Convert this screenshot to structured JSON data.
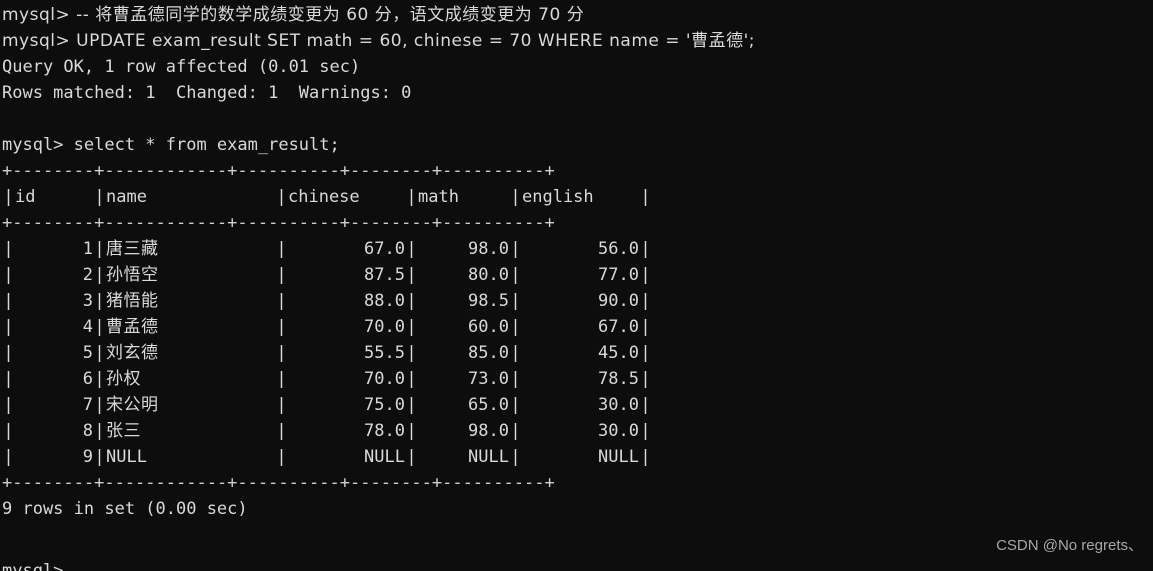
{
  "terminal": {
    "background_color": "#0d0d0d",
    "foreground_color": "#d9d9d9",
    "prompt": "mysql>"
  },
  "session": {
    "line_comment": "mysql> -- 将曹孟德同学的数学成绩变更为 60 分，语文成绩变更为 70 分",
    "line_update": "mysql> UPDATE exam_result SET math = 60, chinese = 70 WHERE name = '曹孟德';",
    "line_query_ok": "Query OK, 1 row affected (0.01 sec)",
    "line_rows_matched": "Rows matched: 1  Changed: 1  Warnings: 0",
    "line_select": "mysql> select * from exam_result;",
    "line_rows_in_set": "9 rows in set (0.00 sec)",
    "line_tail_prompt": "mysql>"
  },
  "result_table": {
    "separator": "+--------+------------+----------+--------+----------+",
    "columns": [
      "id",
      "name",
      "chinese",
      "math",
      "english"
    ],
    "rows": [
      {
        "id": "1",
        "name": "唐三藏",
        "chinese": "67.0",
        "math": "98.0",
        "english": "56.0"
      },
      {
        "id": "2",
        "name": "孙悟空",
        "chinese": "87.5",
        "math": "80.0",
        "english": "77.0"
      },
      {
        "id": "3",
        "name": "猪悟能",
        "chinese": "88.0",
        "math": "98.5",
        "english": "90.0"
      },
      {
        "id": "4",
        "name": "曹孟德",
        "chinese": "70.0",
        "math": "60.0",
        "english": "67.0"
      },
      {
        "id": "5",
        "name": "刘玄德",
        "chinese": "55.5",
        "math": "85.0",
        "english": "45.0"
      },
      {
        "id": "6",
        "name": "孙权",
        "chinese": "70.0",
        "math": "73.0",
        "english": "78.5"
      },
      {
        "id": "7",
        "name": "宋公明",
        "chinese": "75.0",
        "math": "65.0",
        "english": "30.0"
      },
      {
        "id": "8",
        "name": "张三",
        "chinese": "78.0",
        "math": "98.0",
        "english": "30.0"
      },
      {
        "id": "9",
        "name": "NULL",
        "chinese": "NULL",
        "math": "NULL",
        "english": "NULL"
      }
    ],
    "row_count": 9,
    "vertical_bar": "|"
  },
  "watermark": {
    "text": "CSDN @No regrets、"
  }
}
